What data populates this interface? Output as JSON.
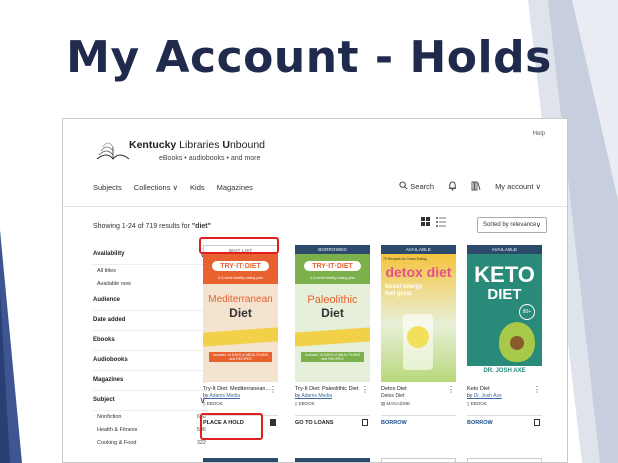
{
  "slide": {
    "title": "My Account - Holds"
  },
  "header": {
    "help": "Help",
    "brand_bold": "Kentucky",
    "brand_rest": " Libraries ",
    "brand_bold2": "U",
    "brand_rest2": "nbound",
    "tagline": "eBooks • audiobooks • and more",
    "nav": [
      "Subjects",
      "Collections ∨",
      "Kids",
      "Magazines"
    ],
    "search": "Search",
    "my_account": "My account ∨"
  },
  "results": {
    "prefix": "Showing 1-24 of 719 results for ",
    "query": "\"diet\""
  },
  "sort": {
    "label": "Sorted by relevance"
  },
  "sidebar": {
    "availability": "Availability",
    "all_titles": "All titles",
    "available_now": "Available now",
    "audience": "Audience",
    "date_added": "Date added",
    "ebooks": "Ebooks",
    "audiobooks": "Audiobooks",
    "magazines": "Magazines",
    "subject": "Subject",
    "nonfiction": "Nonfiction",
    "nonfiction_count": "648",
    "health": "Health & Fitness",
    "health_count": "506",
    "cooking": "Cooking & Food",
    "cooking_count": "322"
  },
  "cards": [
    {
      "status": "WAIT LIST",
      "title": "Try-It Diet: Mediterranean...",
      "author": "Adams Media",
      "format": "EBOOK",
      "action": "PLACE A HOLD",
      "cover_brand": "TRY·IT·DIET",
      "cover_tag": "A 3-week healthy eating plan",
      "cover_t1": "Mediterranean",
      "cover_t2": "Diet",
      "cover_foot": "Includes 14 DAYS of MEAL PLANS and RECIPES"
    },
    {
      "status": "BORROWED",
      "title": "Try-It Diet: Paleolithic Diet",
      "author": "Adams Media",
      "format": "EBOOK",
      "action": "GO TO LOANS",
      "cover_brand": "TRY·IT·DIET",
      "cover_tag": "A 3-week healthy eating plan",
      "cover_t1": "Paleolithic",
      "cover_t2": "Diet",
      "cover_foot": "Includes 14 DAYS of MEAL PLANS and RECIPES"
    },
    {
      "status": "AVAILABLE",
      "title": "Detox Diet",
      "author": "Detox Diet",
      "format": "MAGAZINE",
      "action": "BORROW",
      "cover_t1": "detox diet",
      "cover_tag": "70 Recipes for Clean Eating",
      "cover_sub": "boost energy feel great"
    },
    {
      "status": "AVAILABLE",
      "title": "Keto Diet",
      "author": "Dr. Josh Axe",
      "format": "EBOOK",
      "action": "BORROW",
      "cover_t1": "KETO",
      "cover_t2": "DIET",
      "cover_author": "DR. JOSH AXE",
      "cover_badge": "80+"
    }
  ]
}
